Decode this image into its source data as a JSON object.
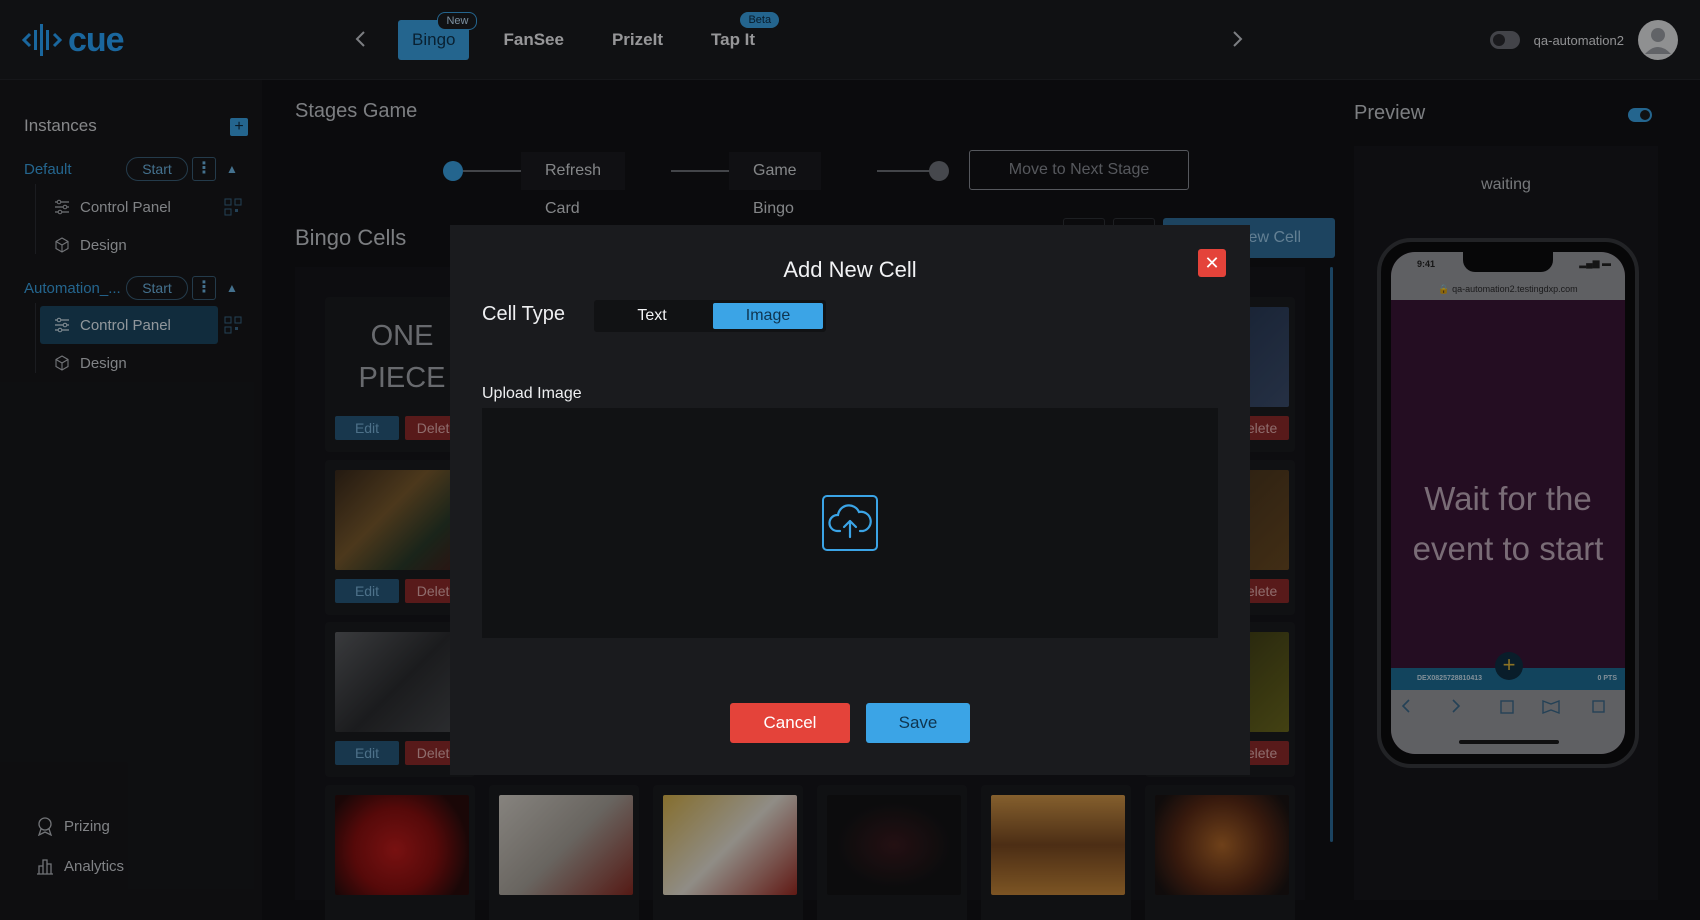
{
  "app": {
    "logo_text": "cue"
  },
  "nav": {
    "tabs": [
      {
        "label": "Bingo",
        "badge": "New"
      },
      {
        "label": "FanSee",
        "badge": ""
      },
      {
        "label": "PrizeIt",
        "badge": ""
      },
      {
        "label": "Tap It",
        "badge": "Beta"
      }
    ],
    "prev_icon": "chevron-left-icon",
    "next_icon": "chevron-right-icon"
  },
  "user": {
    "name": "qa-automation2"
  },
  "sidebar": {
    "heading": "Instances",
    "instances": [
      {
        "name": "Default",
        "start_label": "Start",
        "items": [
          "Control Panel",
          "Design"
        ]
      },
      {
        "name": "Automation_...",
        "start_label": "Start",
        "items": [
          "Control Panel",
          "Design"
        ]
      }
    ],
    "bottom": [
      {
        "label": "Prizing",
        "icon": "award-icon"
      },
      {
        "label": "Analytics",
        "icon": "chart-icon"
      }
    ]
  },
  "main": {
    "title": "Stages Game",
    "stages": [
      "Refresh Card",
      "Game Bingo"
    ],
    "next_stage_label": "Move to Next Stage",
    "cells_title": "Bingo Cells",
    "new_cell_label": "New Cell",
    "cards": [
      {
        "text": "ONE PIECE",
        "edit": "Edit",
        "delete": "Delete"
      },
      {
        "text": "",
        "edit": "Edit",
        "delete": "Delete"
      },
      {
        "text": "",
        "edit": "Edit",
        "delete": "Delete"
      }
    ]
  },
  "preview": {
    "title": "Preview",
    "status": "waiting",
    "phone_time": "9:41",
    "phone_url": "qa-automation2.testingdxp.com",
    "phone_message": "Wait for the event to start",
    "phone_user": "DEX0825728810413",
    "phone_points": "0 PTS"
  },
  "modal": {
    "title": "Add New Cell",
    "cell_type_label": "Cell Type",
    "cell_type_options": [
      "Text",
      "Image"
    ],
    "cell_type_selected": "Image",
    "upload_label": "Upload Image",
    "cancel_label": "Cancel",
    "save_label": "Save"
  },
  "colors": {
    "accent": "#3ba4e6",
    "danger": "#e4433a",
    "background": "#121316"
  }
}
